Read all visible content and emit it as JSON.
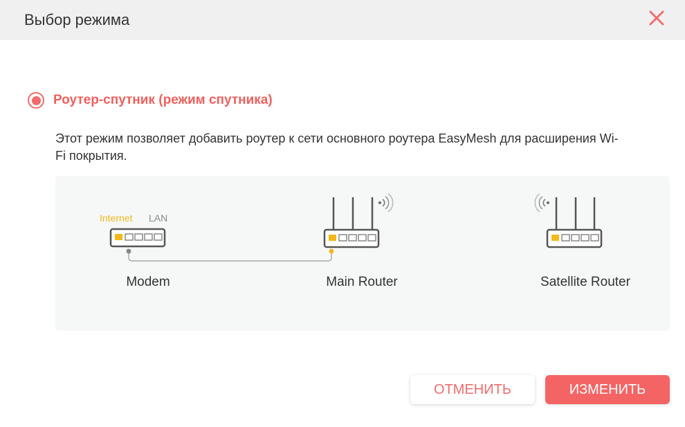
{
  "dialog": {
    "title": "Выбор режима",
    "close_icon": "close-icon"
  },
  "option": {
    "label": "Роутер-спутник (режим спутника)",
    "selected": true,
    "description": "Этот режим позволяет добавить роутер к сети основного роутера EasyMesh для расширения Wi-Fi покрытия."
  },
  "diagram": {
    "internet_label": "Internet",
    "lan_label": "LAN",
    "devices": [
      {
        "name": "Modem",
        "icon": "modem-icon"
      },
      {
        "name": "Main Router",
        "icon": "main-router-icon"
      },
      {
        "name": "Satellite Router",
        "icon": "satellite-router-icon"
      }
    ]
  },
  "buttons": {
    "cancel": "ОТМЕНИТЬ",
    "change": "ИЗМЕНИТЬ"
  },
  "colors": {
    "accent": "#f26b6b",
    "internet_port": "#f2b81c",
    "header_bg": "#f0f0f0",
    "diagram_bg": "#f6f7f7"
  }
}
